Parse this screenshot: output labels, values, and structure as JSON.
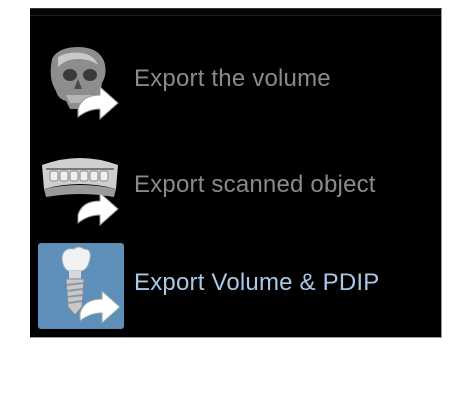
{
  "menu": {
    "items": [
      {
        "label": "Export the volume",
        "icon": "skull-export-icon",
        "active": false
      },
      {
        "label": "Export scanned object",
        "icon": "dental-cast-export-icon",
        "active": false
      },
      {
        "label": "Export Volume & PDIP",
        "icon": "implant-export-icon",
        "active": true
      }
    ]
  },
  "colors": {
    "menu_background": "#000000",
    "label_inactive": "#8a8a8a",
    "label_active": "#a9c8e6",
    "active_icon_background": "#5e8fb8"
  }
}
